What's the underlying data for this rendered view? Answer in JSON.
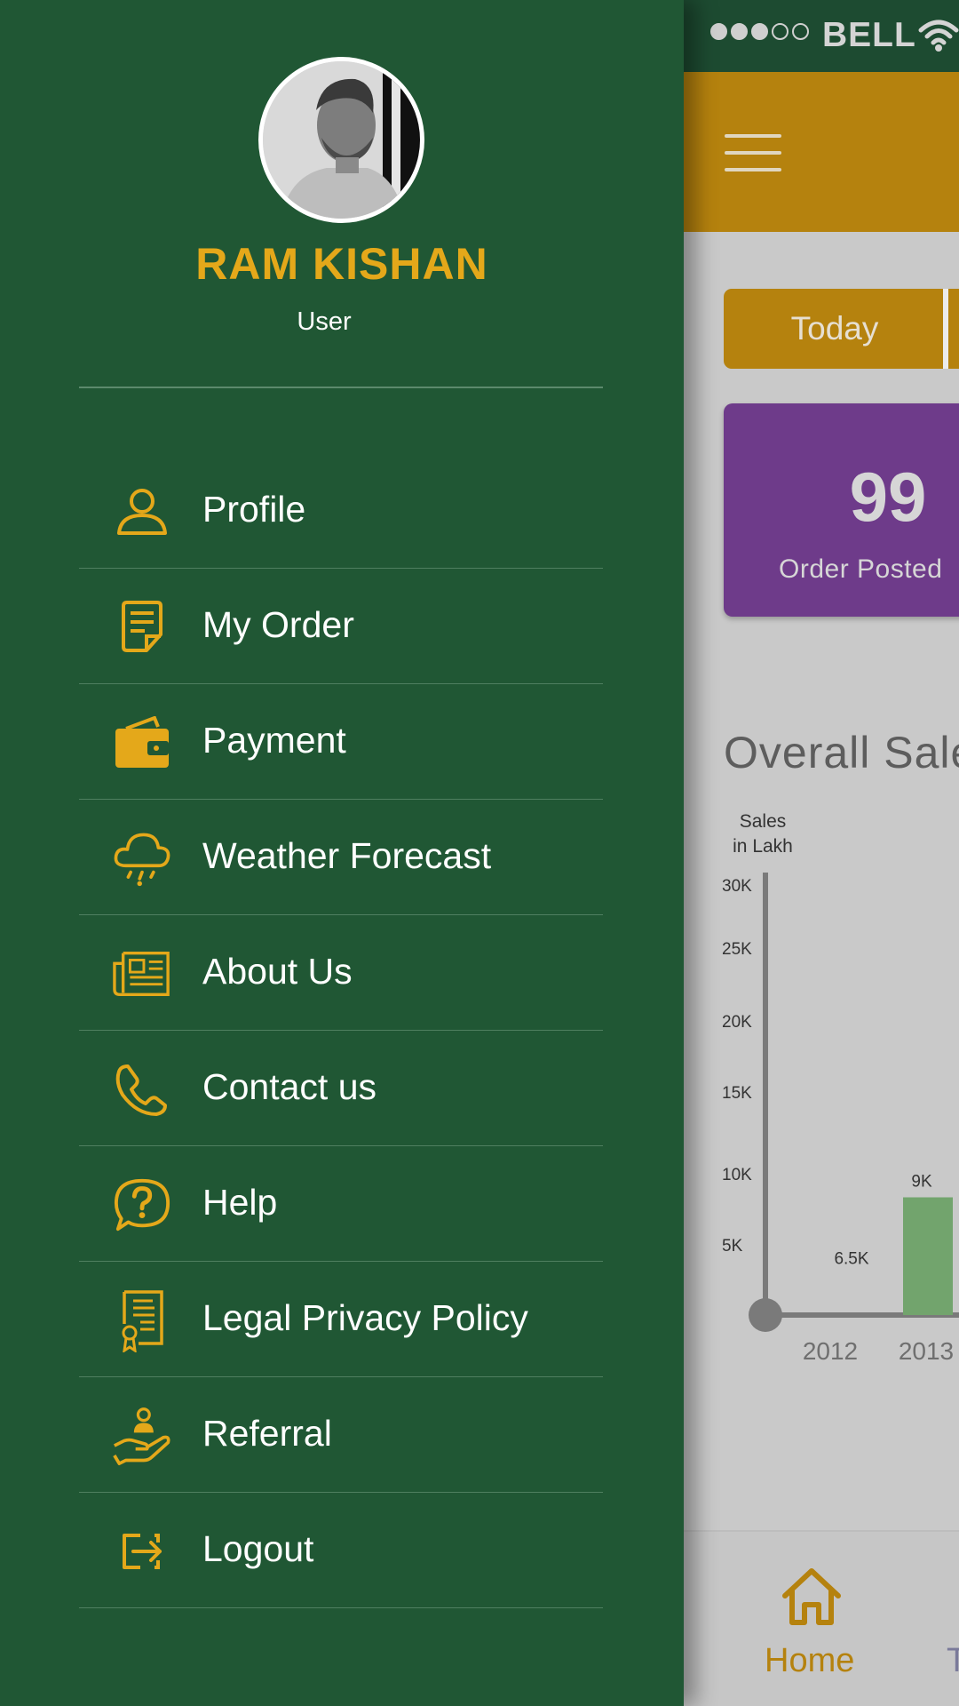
{
  "status_bar": {
    "carrier": "BELL",
    "signal_bars_filled": 3,
    "signal_bars_total": 5
  },
  "header": {
    "menu_icon": "hamburger-icon"
  },
  "tabs": {
    "active_label": "Today"
  },
  "stats_card": {
    "value": "99",
    "label": "Order Posted",
    "color": "#6e3b8a"
  },
  "chart": {
    "title": "Overall Sale",
    "chart_data": {
      "type": "bar",
      "ylabel_lines": [
        "Sales",
        "in Lakh"
      ],
      "y_ticks": [
        "30K",
        "25K",
        "20K",
        "15K",
        "10K",
        "5K"
      ],
      "categories": [
        "2012",
        "2013"
      ],
      "values": [
        6500,
        9000
      ],
      "value_labels": [
        "6.5K",
        "9K"
      ],
      "bar_color": "#72a46d",
      "ylim": [
        0,
        30000
      ]
    }
  },
  "bottom_nav": {
    "home_label": "Home",
    "next_label": "T",
    "accent": "#b5820e"
  },
  "drawer": {
    "user": {
      "name": "RAM KISHAN",
      "role": "User"
    },
    "accent": "#e4a81a",
    "background": "#205734",
    "items": [
      {
        "label": "Profile",
        "icon": "user-icon"
      },
      {
        "label": "My Order",
        "icon": "order-icon"
      },
      {
        "label": "Payment",
        "icon": "wallet-icon"
      },
      {
        "label": "Weather Forecast",
        "icon": "weather-icon"
      },
      {
        "label": "About Us",
        "icon": "newspaper-icon"
      },
      {
        "label": "Contact us",
        "icon": "phone-icon"
      },
      {
        "label": "Help",
        "icon": "help-icon"
      },
      {
        "label": "Legal Privacy Policy",
        "icon": "certificate-icon"
      },
      {
        "label": "Referral",
        "icon": "referral-icon"
      },
      {
        "label": "Logout",
        "icon": "logout-icon"
      }
    ]
  }
}
